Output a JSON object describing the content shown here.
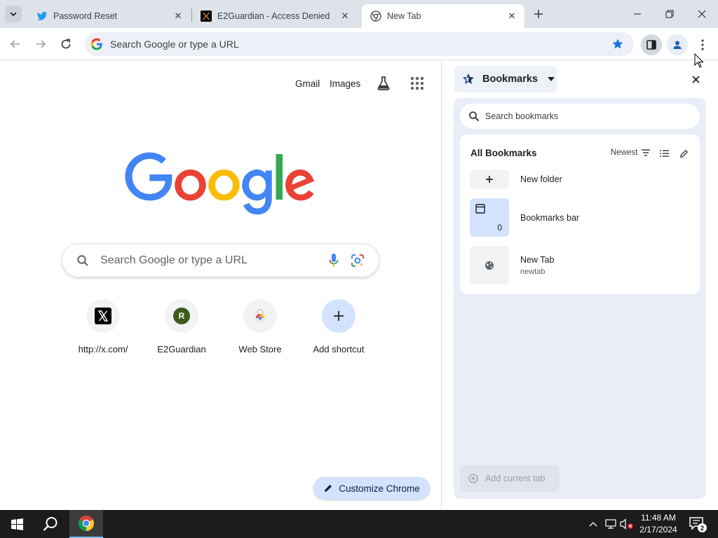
{
  "tabs": [
    {
      "title": "Password Reset",
      "icon": "twitter-bird-icon"
    },
    {
      "title": "E2Guardian - Access Denied",
      "icon": "x-logo-icon"
    },
    {
      "title": "New Tab",
      "icon": "chrome-icon",
      "active": true
    }
  ],
  "omnibox": {
    "text": "Search Google or type a URL"
  },
  "ntp": {
    "links": {
      "gmail": "Gmail",
      "images": "Images"
    },
    "search_placeholder": "Search Google or type a URL",
    "shortcuts": [
      {
        "label": "http://x.com/",
        "icon": "x-logo-icon"
      },
      {
        "label": "E2Guardian",
        "icon": "r-avatar-icon",
        "initial": "R"
      },
      {
        "label": "Web Store",
        "icon": "web-store-icon"
      },
      {
        "label": "Add shortcut",
        "icon": "plus-icon"
      }
    ],
    "customize_label": "Customize Chrome"
  },
  "side_panel": {
    "title": "Bookmarks",
    "search_placeholder": "Search bookmarks",
    "section_title": "All Bookmarks",
    "sort_label": "Newest",
    "items": [
      {
        "title": "New folder",
        "subtitle": ""
      },
      {
        "title": "Bookmarks bar",
        "subtitle": "",
        "count": "0"
      },
      {
        "title": "New Tab",
        "subtitle": "newtab"
      }
    ],
    "add_current_label": "Add current tab"
  },
  "taskbar": {
    "time": "11:48 AM",
    "date": "2/17/2024",
    "notification_count": "2"
  },
  "colors": {
    "accent": "#1a73e8",
    "tabstrip": "#dee3ea",
    "side_panel_body": "#e8edf7",
    "customize_btn": "#d3e3fd"
  }
}
